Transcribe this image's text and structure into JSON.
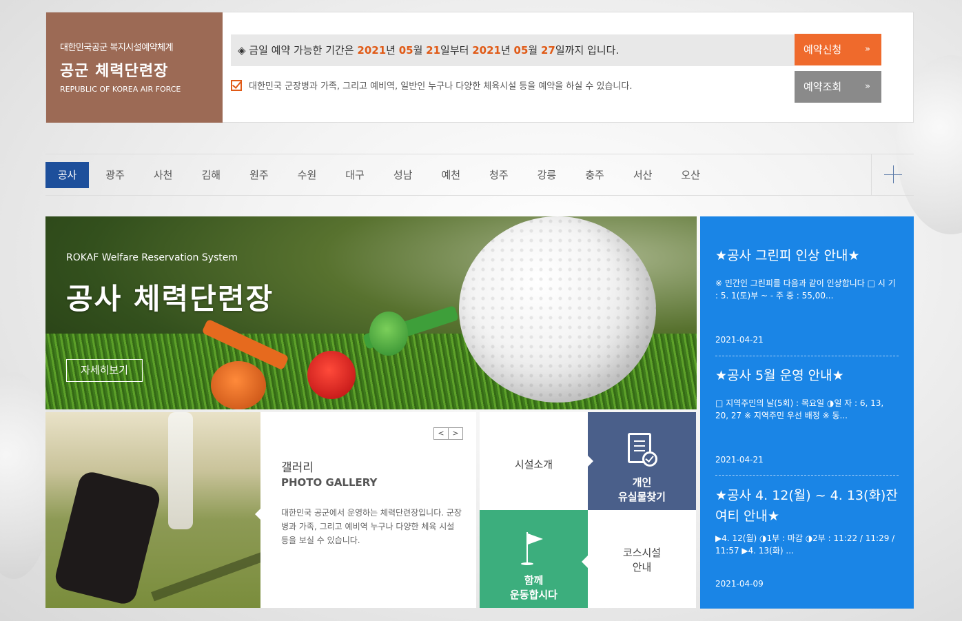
{
  "header": {
    "org_sub": "대한민국공군 복지시설예약체계",
    "org_title": "공군 체력단련장",
    "org_en": "REPUBLIC OF KOREA AIR FORCE",
    "notice": {
      "prefix": "◈ 금일 예약 가능한 기간은 ",
      "y1": "2021",
      "t1": "년 ",
      "m1": "05",
      "t2": "월 ",
      "d1": "21",
      "t3": "일부터 ",
      "y2": "2021",
      "t4": "년 ",
      "m2": "05",
      "t5": "월 ",
      "d2": "27",
      "t6": "일까지 입니다."
    },
    "description": "대한민국 군장병과 가족, 그리고 예비역, 일반인 누구나 다양한 체육시설 등을 예약을 하실 수 있습니다.",
    "apply_button": "예약신청",
    "inquiry_button": "예약조회",
    "arrow": "»"
  },
  "tabs": [
    "공사",
    "광주",
    "사천",
    "김해",
    "원주",
    "수원",
    "대구",
    "성남",
    "예천",
    "청주",
    "강릉",
    "충주",
    "서산",
    "오산"
  ],
  "hero": {
    "subtitle": "ROKAF Welfare Reservation System",
    "title": "공사 체력단련장",
    "button": "자세히보기"
  },
  "gallery": {
    "title": "갤러리",
    "title_en": "PHOTO GALLERY",
    "description": "대한민국 공군에서 운영하는 체력단련장입니다. 군장병과 가족, 그리고 예비역 누구나 다양한 체육 시설 등을 보실 수 있습니다.",
    "prev": "<",
    "next": ">"
  },
  "tiles": {
    "facility": "시설소개",
    "lost_line1": "개인",
    "lost_line2": "유실물찾기",
    "exercise_line1": "함께",
    "exercise_line2": "운동합시다",
    "course_line1": "코스시설",
    "course_line2": "안내"
  },
  "news": [
    {
      "title": "★공사 그린피 인상 안내★",
      "body": "※ 민간인 그린피를 다음과 같이 인상합니다 □ 시 기 : 5. 1(토)부 ~ - 주 중 : 55,00...",
      "date": "2021-04-21"
    },
    {
      "title": "★공사 5월 운영 안내★",
      "body": "□ 지역주민의 날(5회) : 목요일 ◑일 자 : 6, 13, 20, 27 ※ 지역주민 우선 배정 ※ 동...",
      "date": "2021-04-21"
    },
    {
      "title": "★공사 4. 12(월) ~ 4. 13(화)잔여티 안내★",
      "body": "▶4. 12(월) ◑1부 : 마감 ◑2부 : 11:22 / 11:29 / 11:57 ▶4. 13(화) ...",
      "date": "2021-04-09"
    }
  ],
  "colors": {
    "brand_brown": "#9c6a55",
    "accent_orange": "#ef6a2c",
    "tab_active": "#1d4f9b",
    "news_blue": "#1a85e6",
    "tile_navy": "#4a5f8a",
    "tile_green": "#3cae7d"
  }
}
